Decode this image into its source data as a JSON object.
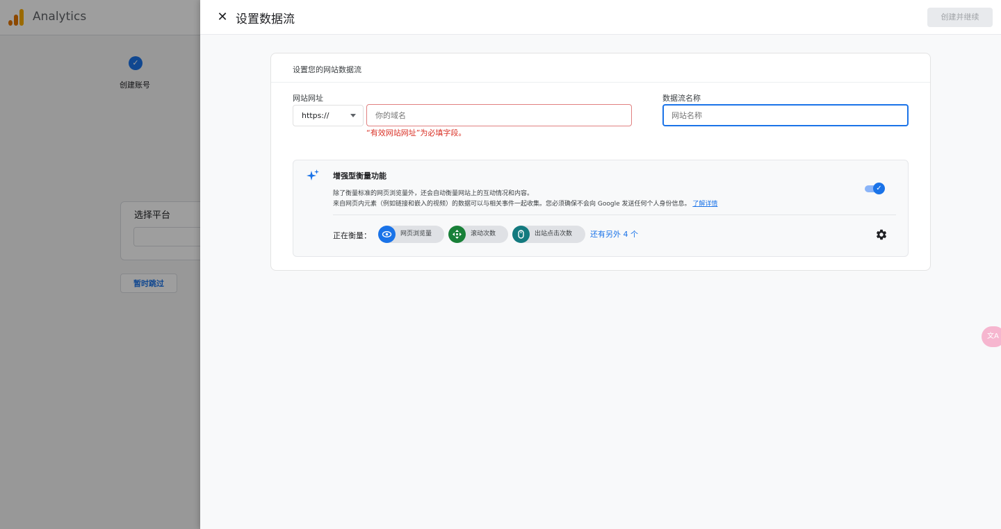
{
  "app": {
    "title": "Analytics"
  },
  "background": {
    "step_check": "✓",
    "step_label": "创建账号",
    "platform_card_title": "选择平台",
    "skip_button": "暂时跳过"
  },
  "drawer": {
    "title": "设置数据流",
    "close_icon": "✕",
    "create_button": "创建并继续"
  },
  "form": {
    "section_title": "设置您的网站数据流",
    "url_label": "网站网址",
    "protocol": "https://",
    "url_placeholder": "你的域名",
    "url_error": "“有效网站网址”为必填字段。",
    "name_label": "数据流名称",
    "name_placeholder": "网站名称"
  },
  "enhanced_measurement": {
    "title": "增强型衡量功能",
    "desc_line1": "除了衡量标准的网页浏览量外，还会自动衡量网站上的互动情况和内容。",
    "desc_line2": "来自网页内元素（例如链接和嵌入的视频）的数据可以与相关事件一起收集。您必须确保不会向 Google 发送任何个人身份信息。",
    "learn_more": "了解详情",
    "enabled": true,
    "measuring_label": "正在衡量：",
    "chips": [
      {
        "label": "网页浏览量",
        "icon": "eye-icon"
      },
      {
        "label": "滚动次数",
        "icon": "scroll-icon"
      },
      {
        "label": "出站点击次数",
        "icon": "mouse-icon"
      }
    ],
    "more_link": "还有另外 4 个"
  },
  "colors": {
    "accent": "#1a73e8",
    "error": "#d93025",
    "chip_scroll": "#188038",
    "chip_outbound": "#137a7f"
  }
}
